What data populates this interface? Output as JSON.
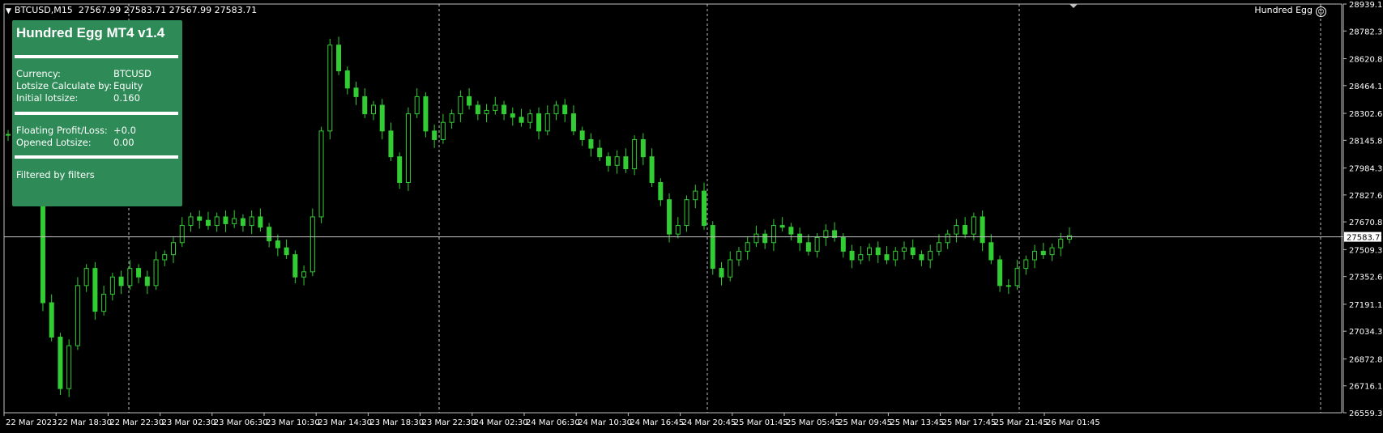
{
  "header": {
    "arrow": "▼",
    "symbol_period": "BTCUSD,M15",
    "ohlc": "27567.99 27583.71 27567.99 27583.71"
  },
  "expert": {
    "name": "Hundred Egg",
    "icon": "smiley-icon"
  },
  "panel": {
    "title": "Hundred Egg MT4 v1.4",
    "rows": [
      {
        "label": "Currency:",
        "value": "BTCUSD"
      },
      {
        "label": "Lotsize Calculate by:",
        "value": "Equity"
      },
      {
        "label": "Initial lotsize:",
        "value": "0.160"
      },
      {
        "label": "Floating Profit/Loss:",
        "value": "+0.0"
      },
      {
        "label": "Opened Lotsize:",
        "value": "0.00"
      }
    ],
    "footer": "Filtered by filters",
    "background": "#2e8b57"
  },
  "chart_data": {
    "type": "candlestick",
    "title": "",
    "xlabel": "",
    "ylabel": "",
    "ylim": [
      26559.35,
      28939.1
    ],
    "y_ticks": [
      "28939.10",
      "28782.35",
      "28620.80",
      "28464.10",
      "28302.60",
      "28145.85",
      "27984.35",
      "27827.60",
      "27670.85",
      "27509.35",
      "27352.60",
      "27191.10",
      "27034.35",
      "26872.85",
      "26716.10",
      "26559.35"
    ],
    "x_ticks": [
      "22 Mar 2023",
      "22 Mar 18:30",
      "22 Mar 22:30",
      "23 Mar 02:30",
      "23 Mar 06:30",
      "23 Mar 10:30",
      "23 Mar 14:30",
      "23 Mar 18:30",
      "23 Mar 22:30",
      "24 Mar 02:30",
      "24 Mar 06:30",
      "24 Mar 10:30",
      "24 Mar 16:45",
      "24 Mar 20:45",
      "25 Mar 01:45",
      "25 Mar 05:45",
      "25 Mar 09:45",
      "25 Mar 13:45",
      "25 Mar 17:45",
      "25 Mar 21:45",
      "26 Mar 01:45"
    ],
    "bid_line": 27583.71,
    "bid_label": "27583.71",
    "colors": {
      "candle": "#32cd32",
      "grid": "#c0c0c0",
      "axis": "#c0c0c0",
      "text": "#ffffff"
    },
    "series": [
      {
        "name": "BTCUSD",
        "values": [
          28180,
          28140,
          28200,
          27800,
          27200,
          27000,
          26700,
          26950,
          27300,
          27400,
          27150,
          27250,
          27350,
          27300,
          27400,
          27350,
          27300,
          27450,
          27480,
          27550,
          27650,
          27700,
          27680,
          27650,
          27700,
          27660,
          27690,
          27650,
          27700,
          27640,
          27560,
          27520,
          27480,
          27350,
          27380,
          27700,
          28200,
          28700,
          28550,
          28450,
          28400,
          28300,
          28350,
          28200,
          28050,
          27900,
          28300,
          28400,
          28200,
          28150,
          28250,
          28300,
          28400,
          28350,
          28300,
          28320,
          28350,
          28300,
          28280,
          28250,
          28300,
          28200,
          28300,
          28350,
          28300,
          28200,
          28150,
          28100,
          28050,
          28000,
          28050,
          27980,
          28150,
          28050,
          27900,
          27800,
          27600,
          27650,
          27800,
          27850,
          27650,
          27400,
          27350,
          27450,
          27500,
          27550,
          27600,
          27550,
          27650,
          27640,
          27600,
          27550,
          27500,
          27580,
          27620,
          27580,
          27500,
          27450,
          27480,
          27520,
          27480,
          27450,
          27500,
          27520,
          27480,
          27450,
          27500,
          27550,
          27600,
          27650,
          27600,
          27700,
          27550,
          27450,
          27300,
          27300,
          27400,
          27450,
          27500,
          27480,
          27520,
          27570,
          27590
        ]
      }
    ]
  }
}
